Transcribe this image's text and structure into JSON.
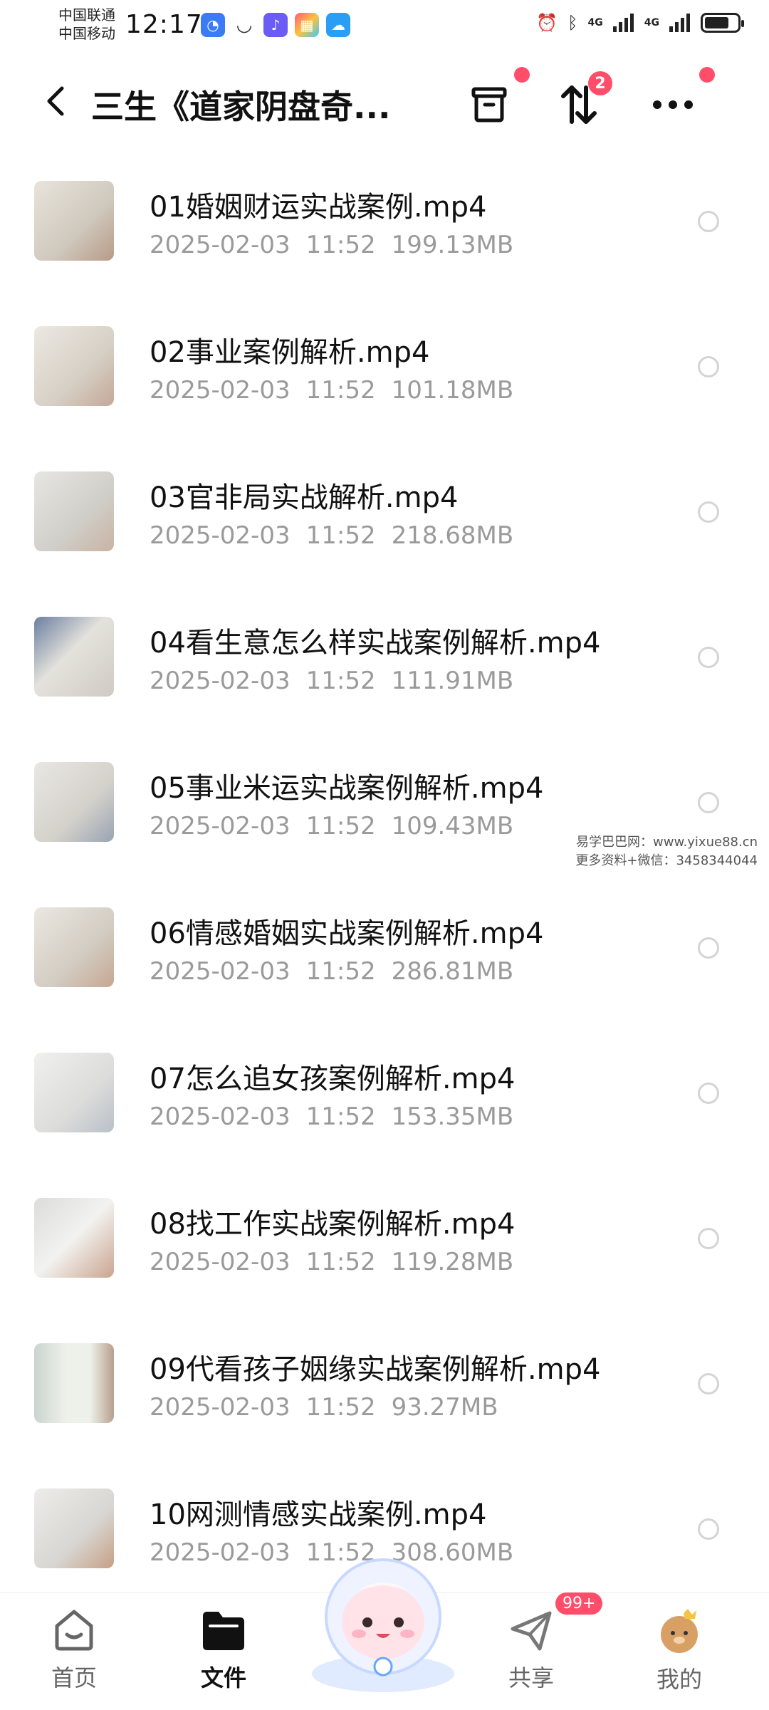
{
  "status_bar": {
    "carrier_1": "中国联通",
    "carrier_2": "中国移动",
    "time": "12:17",
    "network_1": "4G",
    "network_2": "4G",
    "battery_level": 0.75
  },
  "header": {
    "title": "三生《道家阴盘奇...",
    "sort_badge_count": "2"
  },
  "files": [
    {
      "name": "01婚姻财运实战案例.mp4",
      "date": "2025-02-03",
      "time": "11:52",
      "size": "199.13MB"
    },
    {
      "name": "02事业案例解析.mp4",
      "date": "2025-02-03",
      "time": "11:52",
      "size": "101.18MB"
    },
    {
      "name": "03官非局实战解析.mp4",
      "date": "2025-02-03",
      "time": "11:52",
      "size": "218.68MB"
    },
    {
      "name": "04看生意怎么样实战案例解析.mp4",
      "date": "2025-02-03",
      "time": "11:52",
      "size": "111.91MB"
    },
    {
      "name": "05事业米运实战案例解析.mp4",
      "date": "2025-02-03",
      "time": "11:52",
      "size": "109.43MB"
    },
    {
      "name": "06情感婚姻实战案例解析.mp4",
      "date": "2025-02-03",
      "time": "11:52",
      "size": "286.81MB"
    },
    {
      "name": "07怎么追女孩案例解析.mp4",
      "date": "2025-02-03",
      "time": "11:52",
      "size": "153.35MB"
    },
    {
      "name": "08找工作实战案例解析.mp4",
      "date": "2025-02-03",
      "time": "11:52",
      "size": "119.28MB"
    },
    {
      "name": "09代看孩子姻缘实战案例解析.mp4",
      "date": "2025-02-03",
      "time": "11:52",
      "size": "93.27MB"
    },
    {
      "name": "10网测情感实战案例.mp4",
      "date": "2025-02-03",
      "time": "11:52",
      "size": "308.60MB"
    }
  ],
  "watermark": {
    "line1": "易学巴巴网：www.yixue88.cn",
    "line2": "更多资料+微信：3458344044"
  },
  "tabbar": {
    "home": "首页",
    "files": "文件",
    "share": "共享",
    "share_badge": "99+",
    "mine": "我的"
  },
  "colors": {
    "accent_badge": "#ff4d6a",
    "meta_text": "#9a9a9a"
  }
}
